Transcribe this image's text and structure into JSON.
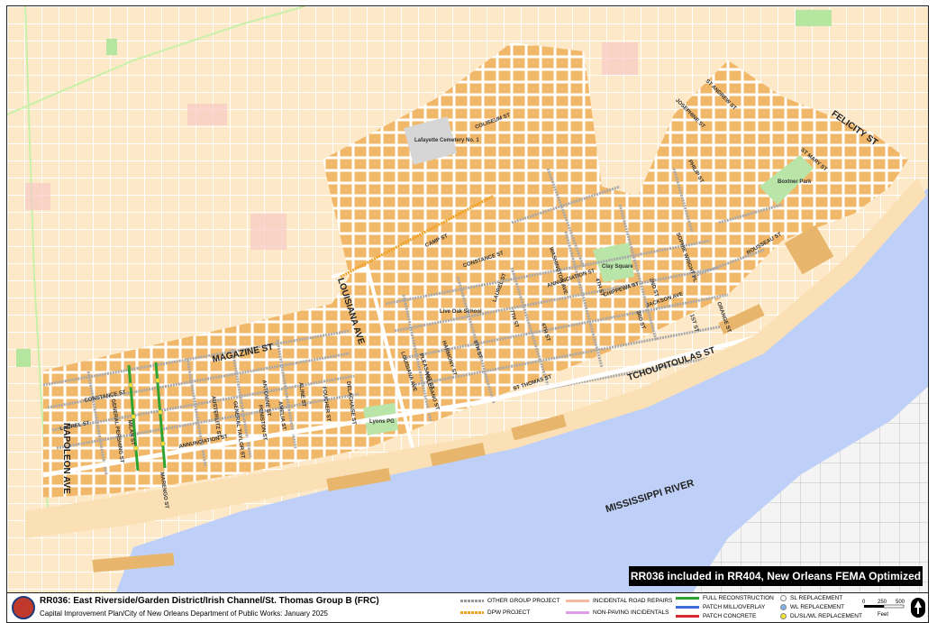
{
  "map": {
    "river_label": "MISSISSIPPI RIVER",
    "banner": "RR036 included in RR404, New Orleans FEMA Optimized Group 4",
    "landmarks": {
      "cemetery": "Lafayette Cemetery No. 1",
      "clay_square": "Clay Square",
      "lyons_pg": "Lyons PG",
      "live_oak": "Live Oak School",
      "boxtner_park": "Boxtner Park"
    },
    "streets_major": {
      "magazine": "MAGAZINE ST",
      "louisiana": "LOUISIANA AVE",
      "tchoupitoulas": "TCHOUPITOULAS ST",
      "napoleon": "NAPOLEON AVE",
      "felicity": "FELICITY ST"
    },
    "streets_minor": {
      "constance_w": "CONSTANCE ST",
      "laurel_w": "LAUREL ST",
      "annunciation_w": "ANNUNCIATION ST",
      "general_pershing": "GENERAL PERSHING ST",
      "milan": "MILAN ST",
      "marengo": "MARENGO ST",
      "peniston": "PENISTON ST",
      "austerlitz": "AUSTERLITZ ST",
      "general_taylor": "GENERAL TAYLOR ST",
      "amelia": "AMELIA ST",
      "antonine": "ANTONINE ST",
      "foucher": "FOUCHER ST",
      "delachaise": "DELACHAISE ST",
      "aline": "ALINE ST",
      "camp": "CAMP ST",
      "constance_e": "CONSTANCE ST",
      "laurel_e": "LAUREL ST",
      "annunciation_e": "ANNUNCIATION ST",
      "chippewa": "CHIPPEWA ST",
      "st_thomas": "ST THOMAS ST",
      "washington": "WASHINGTON AVE",
      "first": "1ST ST",
      "second": "2ND ST",
      "third": "3RD ST",
      "fourth": "4TH ST",
      "sixth": "6TH ST",
      "seventh": "7TH ST",
      "ninth": "9TH ST",
      "harmony": "HARMONY ST",
      "pleasant": "PLEASANT ST",
      "toledano": "TOLEDANO ST",
      "coliseum": "COLISEUM ST",
      "st_andrew": "ST ANDREW ST",
      "josephine": "JOSEPHINE ST",
      "st_mary": "ST MARY ST",
      "sophie_wright": "SOPHIE WRIGHT PL",
      "rousseau": "ROUSSEAU ST",
      "orange": "ORANGE ST",
      "jackson": "JACKSON AVE",
      "philip": "PHILIP ST",
      "louisiana_small": "LOUISIANA AVE"
    }
  },
  "footer": {
    "title": "RR036: East Riverside/Garden District/Irish Channel/St. Thomas Group B (FRC)",
    "subtitle": "Capital Improvement Plan/City of New Orleans Department of Public Works:  January 2025",
    "legend": [
      {
        "label": "OTHER GROUP PROJECT",
        "color": "#9a9a9a"
      },
      {
        "label": "DPW PROJECT",
        "color": "#f0a020"
      },
      {
        "label": "INCIDENTAL ROAD REPAIRS",
        "color": "#f4b9a0"
      },
      {
        "label": "NON-PAVING INCIDENTALS",
        "color": "#e09be8"
      },
      {
        "label": "FULL RECONSTRUCTION",
        "color": "#2fa32f"
      },
      {
        "label": "PATCH MILL/OVERLAY",
        "color": "#3a6fd8"
      },
      {
        "label": "PATCH CONCRETE",
        "color": "#d8282d"
      },
      {
        "label": "SL REPLACEMENT",
        "color": "#ffffff"
      },
      {
        "label": "WL REPLACEMENT",
        "color": "#7fb0e8"
      },
      {
        "label": "DL/SL/WL REPLACEMENT",
        "color": "#f2e233"
      }
    ],
    "scale_labels": [
      "0",
      "250",
      "500"
    ],
    "scale_unit": "Feet"
  }
}
